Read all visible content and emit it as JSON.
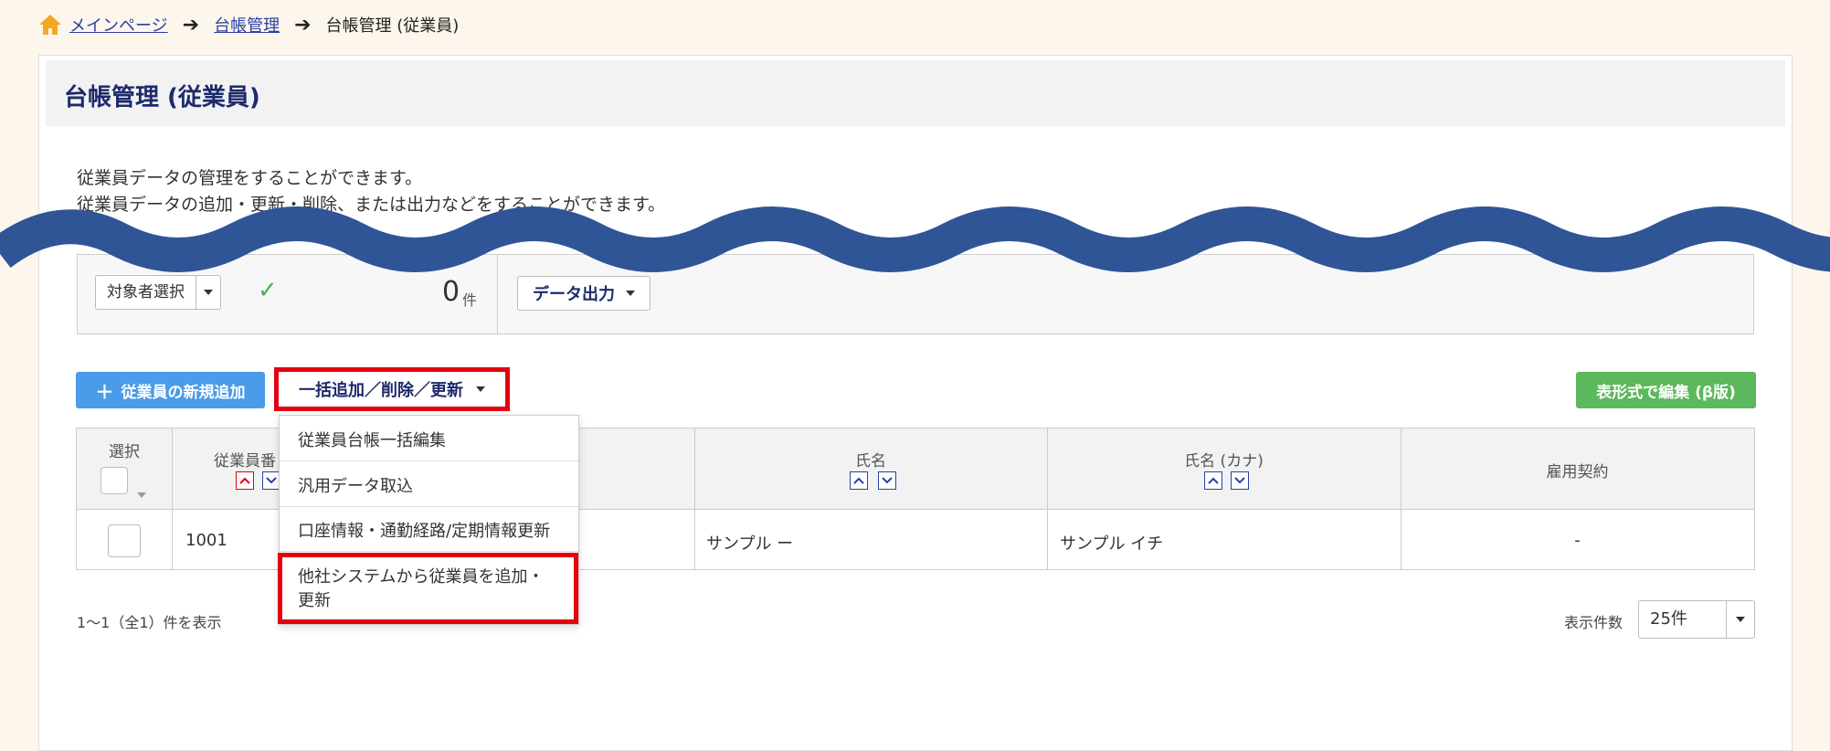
{
  "breadcrumb": {
    "items": [
      {
        "label": "メインページ"
      },
      {
        "label": "台帳管理"
      },
      {
        "label": "台帳管理 (従業員)"
      }
    ]
  },
  "page": {
    "title": "台帳管理 (従業員)",
    "description_line1": "従業員データの管理をすることができます。",
    "description_line2": "従業員データの追加・更新・削除、または出力などをすることができます。"
  },
  "filter": {
    "target_select_label": "対象者選択",
    "count": "0",
    "count_unit": "件",
    "export_label": "データ出力"
  },
  "actions": {
    "add_employee_label": "従業員の新規追加",
    "bulk_label": "一括追加／削除／更新",
    "grid_edit_label": "表形式で編集 (β版)"
  },
  "bulk_menu": {
    "items": [
      "従業員台帳一括編集",
      "汎用データ取込",
      "口座情報・通勤経路/定期情報更新",
      "他社システムから従業員を追加・",
      "更新"
    ]
  },
  "table": {
    "headers": [
      "選択",
      "従業員番",
      "氏名",
      "氏名 (カナ)",
      "雇用契約"
    ],
    "rows": [
      {
        "employee_no": "1001",
        "name": "サンプル ー",
        "kana": "サンプル イチ",
        "contract": "-"
      }
    ]
  },
  "footer": {
    "paging_text": "1～1（全1）件を表示",
    "per_page_label": "表示件数",
    "per_page_value": "25件"
  },
  "colors": {
    "accent_red": "#e3000f",
    "primary_blue": "#4a9be8",
    "success_green": "#5cb85c",
    "wave_blue": "#2f5597",
    "home_icon": "#f5a623"
  }
}
